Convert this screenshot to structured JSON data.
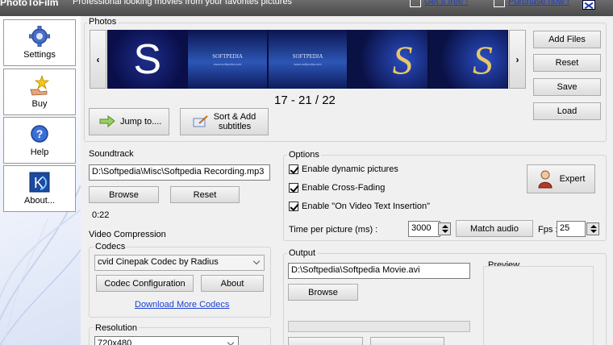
{
  "titlebar": {
    "app_name": "PhotoToFilm",
    "tagline": "Professional looking movies from your favorites pictures",
    "get_it_free": "Get it free !",
    "purchase_now": "Purchase now !"
  },
  "nav": [
    {
      "label": "Settings",
      "icon": "settings-gear-icon"
    },
    {
      "label": "Buy",
      "icon": "buy-hand-star-icon"
    },
    {
      "label": "Help",
      "icon": "help-question-icon"
    },
    {
      "label": "About...",
      "icon": "about-k-logo-icon"
    }
  ],
  "photos": {
    "label": "Photos",
    "prev": "‹",
    "next": "›",
    "thumb_texts": {
      "s_letter": "S",
      "softpedia": "SOFTPEDIA",
      "url": "www.softpedia.com"
    },
    "counter": "17 - 21 / 22",
    "add_files": "Add Files",
    "reset": "Reset",
    "save": "Save",
    "load": "Load",
    "jump_to": "Jump to....",
    "sort_add_line1": "Sort & Add",
    "sort_add_line2": "subtitles"
  },
  "soundtrack": {
    "label": "Soundtrack",
    "path": "D:\\Softpedia\\Misc\\Softpedia Recording.mp3",
    "browse": "Browse",
    "reset": "Reset",
    "duration": "0:22"
  },
  "video_compression": {
    "label": "Video Compression",
    "codecs_label": "Codecs",
    "codec_selected": "cvid Cinepak Codec by Radius",
    "codec_config": "Codec Configuration",
    "about": "About",
    "download_more": "Download More Codecs",
    "resolution_label": "Resolution",
    "resolution_selected": "720x480"
  },
  "options": {
    "label": "Options",
    "enable_dynamic": "Enable dynamic pictures",
    "enable_crossfade": "Enable Cross-Fading",
    "enable_text": "Enable \"On Video Text Insertion\"",
    "expert": "Expert",
    "time_per_picture_label": "Time per picture (ms) :",
    "time_per_picture": "3000",
    "match_audio": "Match audio",
    "fps_label": "Fps :",
    "fps": "25"
  },
  "output": {
    "label": "Output",
    "path": "D:\\Softpedia\\Softpedia Movie.avi",
    "browse": "Browse"
  },
  "preview": {
    "label": "Preview"
  }
}
